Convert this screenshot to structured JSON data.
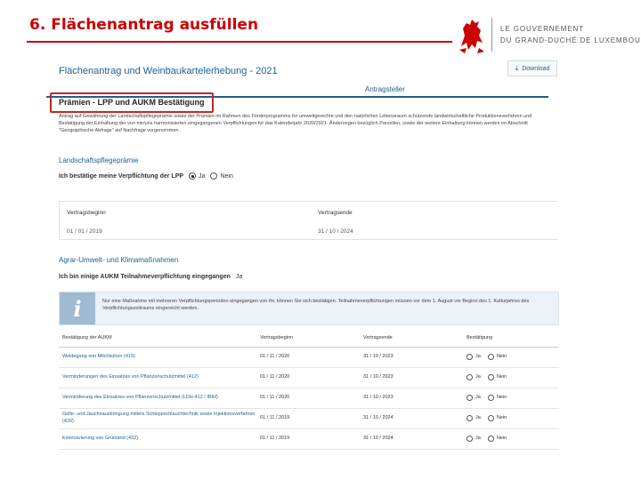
{
  "slide": {
    "title": "6. Flächenantrag ausfüllen",
    "gov_line1": "LE GOUVERNEMENT",
    "gov_line2": "DU GRAND-DUCHÉ DE LUXEMBOURG"
  },
  "form": {
    "title": "Flächenantrag und Weinbaukartelerhebung - 2021",
    "download_label": "Download",
    "tab_label": "Antragsteller",
    "section_title": "Prämien - LPP und AUKM Bestätigung",
    "intro_text": "Antrag auf Gewährung der Landschaftspflegeprämie sowie der Prämien im Rahmen des Förderprogramms für umweltgerechte und den natürlichen Lebensraum schützende landwirtschaftliche Produktionsverfahren und Bestätigung der Einhaltung der von mir/uns harmonisierten eingegangenen Verpflichtungen für das Kalenderjahr 2020/2021. Änderungen bezüglich Parzellen, sowie der weitere Einhaltung können werden im Abschnitt \"Geographische Abfrage\" auf Nachfrage vorgenommen.",
    "lpp": {
      "heading": "Landschaftspflegeprämie",
      "confirm_label": "Ich bestätige meine Verpflichtung der LPP",
      "yes": "Ja",
      "no": "Nein",
      "begin_label": "Vertragsbeginn",
      "end_label": "Vertragsende",
      "begin_value": "01 / 01 / 2019",
      "end_value": "31 / 10 / 2024"
    },
    "agrar": {
      "heading": "Agrar-Umwelt- und Klimamaßnahmen",
      "confirm_label": "Ich bin einige AUKM Teilnahmeverpflichtung eingegangen",
      "confirm_value": "Ja",
      "info_text": "Nur eine Maßnahme mit mehreren Verpflichtungsperioden eingegangen von Ihr, können Sie sich bestätigen. Teilnahmeverpflichtungen müssen vor dem 1. August vor Beginn des 1. Kulturjahres des Verpflichtungszeitraums eingereicht werden.",
      "table_headers": [
        "Bestätigung der AUKM",
        "Vertragsbeginn",
        "Vertragsende",
        "Bestätigung"
      ],
      "rows": [
        {
          "name": "Weidegang von Milchkühen (415)",
          "begin": "01 / 11 / 2020",
          "end": "31 / 10 / 2023",
          "yes": "Ja",
          "no": "Nein"
        },
        {
          "name": "Verminderungen des Einsatzes von Pflanzenschutzmittel (412)",
          "begin": "01 / 11 / 2020",
          "end": "31 / 10 / 2023",
          "yes": "Ja",
          "no": "Nein"
        },
        {
          "name": "Verminderung des Einsatzes von Pflanzenschutzmittel (LDH-412 / IBIH)",
          "begin": "01 / 11 / 2020",
          "end": "31 / 10 / 2023",
          "yes": "Ja",
          "no": "Nein"
        },
        {
          "name": "Gülle- und Jaucheausbringung mittels Schleppschlauchtechnik sowie Injektionsverfahren (420)",
          "begin": "01 / 11 / 2019",
          "end": "31 / 10 / 2024",
          "yes": "Ja",
          "no": "Nein"
        },
        {
          "name": "Extensivierung von Grünland (432)",
          "begin": "01 / 11 / 2019",
          "end": "31 / 10 / 2024",
          "yes": "Ja",
          "no": "Nein"
        }
      ]
    }
  }
}
